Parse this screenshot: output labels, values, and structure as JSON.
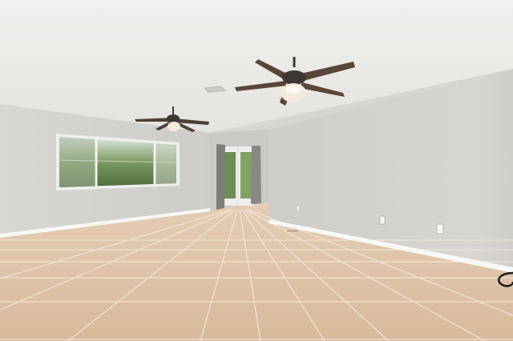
{
  "scene": {
    "kind": "interior-photo",
    "colors": {
      "ceiling": "#ecebe8",
      "wall_left": "#d6d4d0",
      "wall_right": "#d2d0cc",
      "wall_back": "#c9c7c3",
      "baseboard": "#f8f8f6",
      "floor_tile": "#ddc1a6",
      "grout": "#efe1d1",
      "fan_blade": "#5a4638",
      "fan_body": "#3d3733",
      "light_glass": "#f4eadb",
      "window_frame": "#f2f2f0",
      "foliage": "#6b8a52",
      "curtain": "#7d7b77"
    },
    "objects": [
      "ceiling-fan-near",
      "ceiling-fan-far",
      "window-left-wall",
      "french-doors",
      "curtains",
      "wall-outlets",
      "tile-floor",
      "ceiling-vent",
      "black-cable"
    ]
  }
}
